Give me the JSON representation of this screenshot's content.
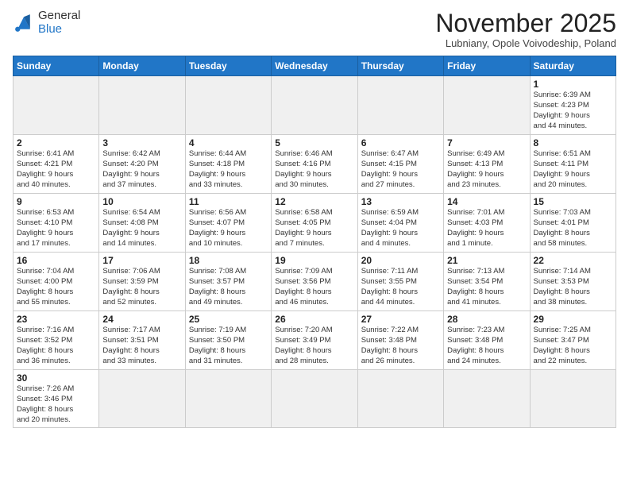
{
  "logo": {
    "text_general": "General",
    "text_blue": "Blue"
  },
  "header": {
    "month": "November 2025",
    "location": "Lubniany, Opole Voivodeship, Poland"
  },
  "weekdays": [
    "Sunday",
    "Monday",
    "Tuesday",
    "Wednesday",
    "Thursday",
    "Friday",
    "Saturday"
  ],
  "weeks": [
    [
      {
        "day": "",
        "info": ""
      },
      {
        "day": "",
        "info": ""
      },
      {
        "day": "",
        "info": ""
      },
      {
        "day": "",
        "info": ""
      },
      {
        "day": "",
        "info": ""
      },
      {
        "day": "",
        "info": ""
      },
      {
        "day": "1",
        "info": "Sunrise: 6:39 AM\nSunset: 4:23 PM\nDaylight: 9 hours\nand 44 minutes."
      }
    ],
    [
      {
        "day": "2",
        "info": "Sunrise: 6:41 AM\nSunset: 4:21 PM\nDaylight: 9 hours\nand 40 minutes."
      },
      {
        "day": "3",
        "info": "Sunrise: 6:42 AM\nSunset: 4:20 PM\nDaylight: 9 hours\nand 37 minutes."
      },
      {
        "day": "4",
        "info": "Sunrise: 6:44 AM\nSunset: 4:18 PM\nDaylight: 9 hours\nand 33 minutes."
      },
      {
        "day": "5",
        "info": "Sunrise: 6:46 AM\nSunset: 4:16 PM\nDaylight: 9 hours\nand 30 minutes."
      },
      {
        "day": "6",
        "info": "Sunrise: 6:47 AM\nSunset: 4:15 PM\nDaylight: 9 hours\nand 27 minutes."
      },
      {
        "day": "7",
        "info": "Sunrise: 6:49 AM\nSunset: 4:13 PM\nDaylight: 9 hours\nand 23 minutes."
      },
      {
        "day": "8",
        "info": "Sunrise: 6:51 AM\nSunset: 4:11 PM\nDaylight: 9 hours\nand 20 minutes."
      }
    ],
    [
      {
        "day": "9",
        "info": "Sunrise: 6:53 AM\nSunset: 4:10 PM\nDaylight: 9 hours\nand 17 minutes."
      },
      {
        "day": "10",
        "info": "Sunrise: 6:54 AM\nSunset: 4:08 PM\nDaylight: 9 hours\nand 14 minutes."
      },
      {
        "day": "11",
        "info": "Sunrise: 6:56 AM\nSunset: 4:07 PM\nDaylight: 9 hours\nand 10 minutes."
      },
      {
        "day": "12",
        "info": "Sunrise: 6:58 AM\nSunset: 4:05 PM\nDaylight: 9 hours\nand 7 minutes."
      },
      {
        "day": "13",
        "info": "Sunrise: 6:59 AM\nSunset: 4:04 PM\nDaylight: 9 hours\nand 4 minutes."
      },
      {
        "day": "14",
        "info": "Sunrise: 7:01 AM\nSunset: 4:03 PM\nDaylight: 9 hours\nand 1 minute."
      },
      {
        "day": "15",
        "info": "Sunrise: 7:03 AM\nSunset: 4:01 PM\nDaylight: 8 hours\nand 58 minutes."
      }
    ],
    [
      {
        "day": "16",
        "info": "Sunrise: 7:04 AM\nSunset: 4:00 PM\nDaylight: 8 hours\nand 55 minutes."
      },
      {
        "day": "17",
        "info": "Sunrise: 7:06 AM\nSunset: 3:59 PM\nDaylight: 8 hours\nand 52 minutes."
      },
      {
        "day": "18",
        "info": "Sunrise: 7:08 AM\nSunset: 3:57 PM\nDaylight: 8 hours\nand 49 minutes."
      },
      {
        "day": "19",
        "info": "Sunrise: 7:09 AM\nSunset: 3:56 PM\nDaylight: 8 hours\nand 46 minutes."
      },
      {
        "day": "20",
        "info": "Sunrise: 7:11 AM\nSunset: 3:55 PM\nDaylight: 8 hours\nand 44 minutes."
      },
      {
        "day": "21",
        "info": "Sunrise: 7:13 AM\nSunset: 3:54 PM\nDaylight: 8 hours\nand 41 minutes."
      },
      {
        "day": "22",
        "info": "Sunrise: 7:14 AM\nSunset: 3:53 PM\nDaylight: 8 hours\nand 38 minutes."
      }
    ],
    [
      {
        "day": "23",
        "info": "Sunrise: 7:16 AM\nSunset: 3:52 PM\nDaylight: 8 hours\nand 36 minutes."
      },
      {
        "day": "24",
        "info": "Sunrise: 7:17 AM\nSunset: 3:51 PM\nDaylight: 8 hours\nand 33 minutes."
      },
      {
        "day": "25",
        "info": "Sunrise: 7:19 AM\nSunset: 3:50 PM\nDaylight: 8 hours\nand 31 minutes."
      },
      {
        "day": "26",
        "info": "Sunrise: 7:20 AM\nSunset: 3:49 PM\nDaylight: 8 hours\nand 28 minutes."
      },
      {
        "day": "27",
        "info": "Sunrise: 7:22 AM\nSunset: 3:48 PM\nDaylight: 8 hours\nand 26 minutes."
      },
      {
        "day": "28",
        "info": "Sunrise: 7:23 AM\nSunset: 3:48 PM\nDaylight: 8 hours\nand 24 minutes."
      },
      {
        "day": "29",
        "info": "Sunrise: 7:25 AM\nSunset: 3:47 PM\nDaylight: 8 hours\nand 22 minutes."
      }
    ],
    [
      {
        "day": "30",
        "info": "Sunrise: 7:26 AM\nSunset: 3:46 PM\nDaylight: 8 hours\nand 20 minutes."
      },
      {
        "day": "",
        "info": ""
      },
      {
        "day": "",
        "info": ""
      },
      {
        "day": "",
        "info": ""
      },
      {
        "day": "",
        "info": ""
      },
      {
        "day": "",
        "info": ""
      },
      {
        "day": "",
        "info": ""
      }
    ]
  ]
}
